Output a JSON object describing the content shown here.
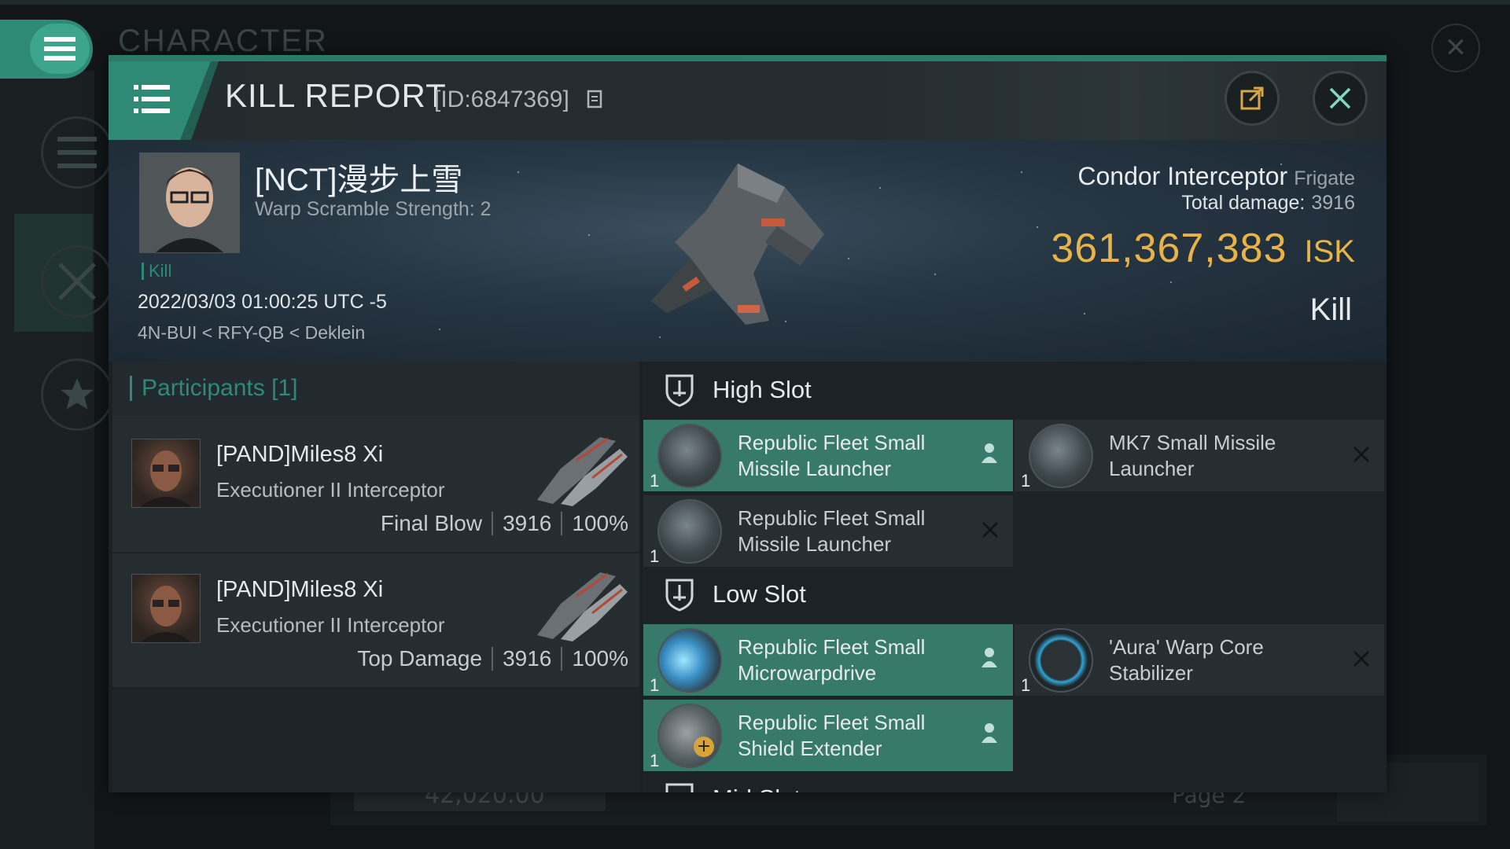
{
  "background": {
    "window_title": "CHARACTER",
    "bottom_value": "42,020.00",
    "page_label": "Page 2"
  },
  "header": {
    "title": "KILL REPORT",
    "report_id": "[ID:6847369]",
    "copy_icon": "copy-icon",
    "share_icon": "share-external-icon",
    "close_icon": "close-icon",
    "menu_icon": "hamburger-menu-icon"
  },
  "victim": {
    "name": "[NCT]漫步上雪",
    "warp_scramble": "Warp Scramble Strength: 2",
    "tag": "Kill",
    "datetime": "2022/03/03 01:00:25 UTC -5",
    "location": "4N-BUI < RFY-QB < Deklein",
    "ship_name": "Condor Interceptor",
    "ship_class": "Frigate",
    "total_damage_label": "Total damage:",
    "total_damage": "3916",
    "isk_value": "361,367,383",
    "isk_unit": "ISK",
    "result": "Kill"
  },
  "participants": {
    "title": "Participants",
    "count": "[1]",
    "rows": [
      {
        "name": "[PAND]Miles8 Xi",
        "ship": "Executioner II Interceptor",
        "role": "Final Blow",
        "damage": "3916",
        "percent": "100%"
      },
      {
        "name": "[PAND]Miles8 Xi",
        "ship": "Executioner II Interceptor",
        "role": "Top Damage",
        "damage": "3916",
        "percent": "100%"
      }
    ]
  },
  "fitting": {
    "high_slot": {
      "label": "High Slot",
      "modules": [
        {
          "name_line1": "Republic Fleet Small",
          "name_line2": "Missile Launcher",
          "qty": "1",
          "status": "fitted",
          "icon": "missile-launcher-icon"
        },
        {
          "name_line1": "MK7 Small Missile",
          "name_line2": "Launcher",
          "qty": "1",
          "status": "destroyed",
          "icon": "missile-launcher-icon"
        },
        {
          "name_line1": "Republic Fleet Small",
          "name_line2": "Missile Launcher",
          "qty": "1",
          "status": "destroyed",
          "icon": "missile-launcher-icon"
        }
      ]
    },
    "low_slot": {
      "label": "Low Slot",
      "modules": [
        {
          "name_line1": "Republic Fleet Small",
          "name_line2": "Microwarpdrive",
          "qty": "1",
          "status": "fitted",
          "icon": "microwarpdrive-icon"
        },
        {
          "name_line1": "'Aura' Warp Core",
          "name_line2": "Stabilizer",
          "qty": "1",
          "status": "destroyed",
          "icon": "warp-core-stabilizer-icon"
        },
        {
          "name_line1": "Republic Fleet Small",
          "name_line2": "Shield Extender",
          "qty": "1",
          "status": "fitted",
          "icon": "shield-extender-icon"
        }
      ]
    },
    "mid_slot": {
      "label": "Mid Slot"
    }
  },
  "colors": {
    "accent": "#2f8a75",
    "isk": "#e9b447",
    "fitted_bg": "#37796b",
    "dropped_bg": "#272e32"
  }
}
